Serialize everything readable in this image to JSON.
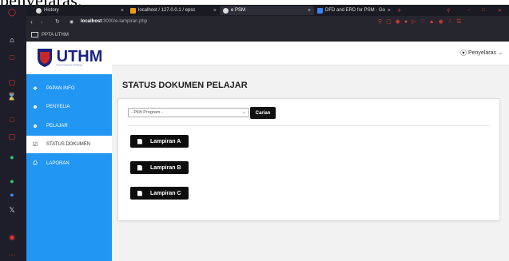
{
  "doc_crop_text": "penyelaras.",
  "browser": {
    "tabs": [
      {
        "label": "History",
        "active": false
      },
      {
        "label": "localhost / 127.0.0.1 / epsc",
        "active": false
      },
      {
        "label": "e PSM",
        "active": true
      },
      {
        "label": "DFD and ERD for PSM · Go",
        "active": false
      }
    ],
    "new_tab": "+",
    "tab_close": "×",
    "url_host": "localhost",
    "url_path": ":3000/e-lampiran.php",
    "bookmark": "PPTA UTHM",
    "window_controls": {
      "minimize": "–",
      "restore": "□",
      "close": "✕"
    }
  },
  "app": {
    "logo_text": "UTHM",
    "logo_sub": "Universiti Tun Hussein Onn Malaysia",
    "nav": [
      {
        "label": "PAPAN INFO",
        "icon": "bullhorn-icon",
        "active": false
      },
      {
        "label": "PENYELIA",
        "icon": "user-icon",
        "active": false
      },
      {
        "label": "PELAJAR",
        "icon": "user-icon",
        "active": false
      },
      {
        "label": "STATUS DOKUMEN",
        "icon": "checkbox-icon",
        "active": true
      },
      {
        "label": "LAPORAN",
        "icon": "print-icon",
        "active": false
      }
    ],
    "user_label": "Penyelaras",
    "page_title": "STATUS DOKUMEN PELAJAR",
    "program_select": "- Pilih Program -",
    "search_button": "Carian",
    "documents": [
      "Lampiran A",
      "Lampiran B",
      "Lampiran C"
    ]
  },
  "colors": {
    "sidebar": "#2196f3",
    "button": "#0d0d0d",
    "browser_accent": "#e53935"
  }
}
